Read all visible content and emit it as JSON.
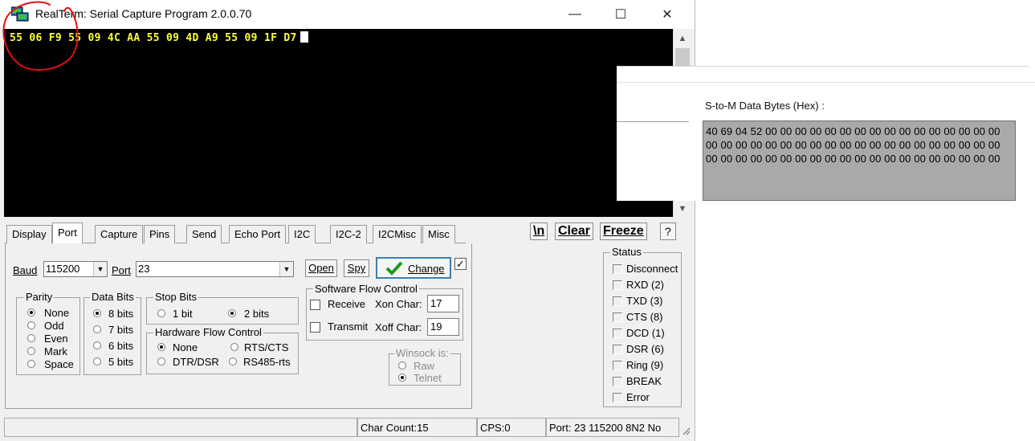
{
  "window": {
    "title": "RealTerm: Serial Capture Program 2.0.0.70",
    "controls": {
      "minimize": "—",
      "maximize": "☐",
      "close": "✕"
    }
  },
  "terminal": {
    "content": "55 06 F9 55 09 4C AA 55 09 4D A9 55 09 1F D7"
  },
  "tabs": [
    "Display",
    "Port",
    "Capture",
    "Pins",
    "Send",
    "Echo Port",
    "I2C",
    "I2C-2",
    "I2CMisc",
    "Misc"
  ],
  "toolbar": {
    "newline": "\\n",
    "clear": "Clear",
    "freeze": "Freeze",
    "help": "?"
  },
  "port": {
    "baud_label": "Baud",
    "baud_value": "115200",
    "port_label": "Port",
    "port_value": "23",
    "open_label": "Open",
    "spy_label": "Spy",
    "change_label": "Change",
    "change_checked": "✓",
    "parity": {
      "title": "Parity",
      "options": [
        "None",
        "Odd",
        "Even",
        "Mark",
        "Space"
      ],
      "selected": "None"
    },
    "data_bits": {
      "title": "Data Bits",
      "options": [
        "8 bits",
        "7 bits",
        "6 bits",
        "5 bits"
      ],
      "selected": "8 bits"
    },
    "stop_bits": {
      "title": "Stop Bits",
      "options": [
        "1 bit",
        "2 bits"
      ],
      "selected": "2 bits"
    },
    "hw_flow": {
      "title": "Hardware Flow Control",
      "options": [
        "None",
        "RTS/CTS",
        "DTR/DSR",
        "RS485-rts"
      ],
      "selected": "None"
    },
    "sw_flow": {
      "title": "Software Flow Control",
      "receive_label": "Receive",
      "transmit_label": "Transmit",
      "xon_label": "Xon Char:",
      "xon_value": "17",
      "xoff_label": "Xoff Char:",
      "xoff_value": "19"
    },
    "winsock": {
      "title": "Winsock is:",
      "options": [
        "Raw",
        "Telnet"
      ],
      "selected": "Telnet"
    }
  },
  "status": {
    "title": "Status",
    "items": [
      "Disconnect",
      "RXD (2)",
      "TXD (3)",
      "CTS (8)",
      "DCD (1)",
      "DSR (6)",
      "Ring (9)",
      "BREAK",
      "Error"
    ]
  },
  "statusbar": {
    "char_count": "Char Count:15",
    "cps": "CPS:0",
    "port_info": "Port: 23 115200 8N2 No"
  },
  "right_panel": {
    "label": "S-to-M Data Bytes (Hex) :",
    "rows": [
      "40 69 04 52 00 00 00 00 00 00 00 00 00 00 00 00 00 00 00 00",
      "00 00 00 00 00 00 00 00 00 00 00 00 00 00 00 00 00 00 00 00",
      "00 00 00 00 00 00 00 00 00 00 00 00 00 00 00 00 00 00 00 00"
    ]
  },
  "colors": {
    "terminal_bg": "#000000",
    "terminal_text": "#ffff33",
    "annotation": "#e01010"
  }
}
